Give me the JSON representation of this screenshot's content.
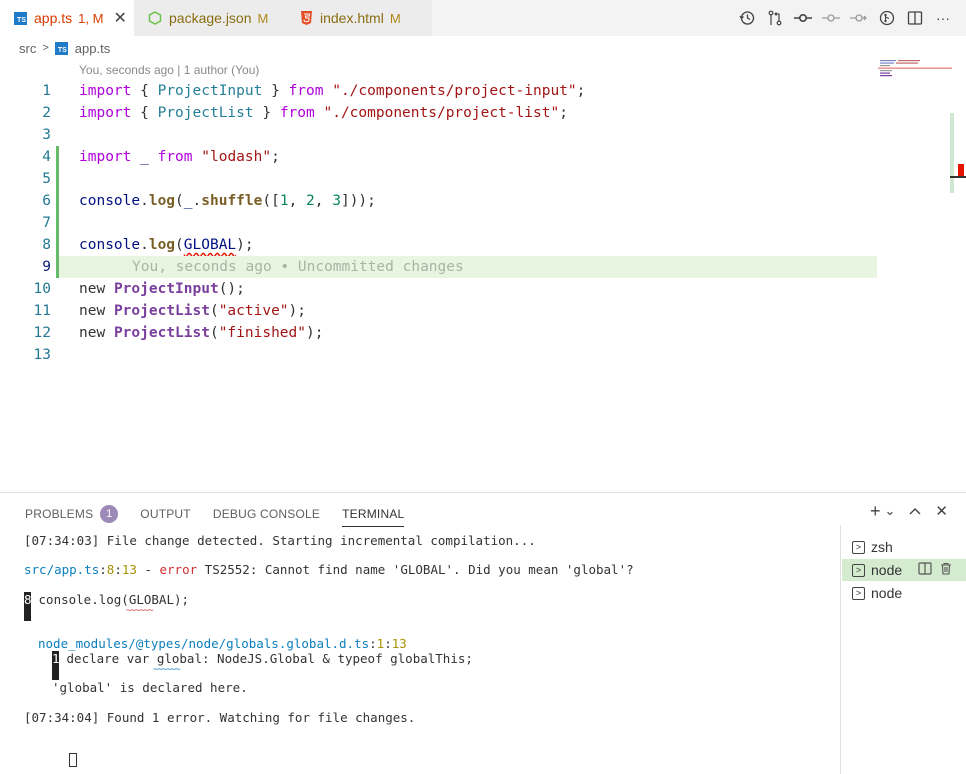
{
  "tabs": [
    {
      "label": "app.ts",
      "status": "1, M",
      "icon": "typescript-icon",
      "active": true,
      "close": "✕"
    },
    {
      "label": "package.json",
      "status": "M",
      "icon": "nodejs-icon",
      "active": false
    },
    {
      "label": "index.html",
      "status": "M",
      "icon": "html5-icon",
      "active": false
    }
  ],
  "toolbar": {
    "icons": [
      "timeline-history-icon",
      "compare-changes-icon",
      "git-commit-icon",
      "previous-change-icon",
      "next-change-icon",
      "open-changes-icon",
      "split-editor-icon",
      "more-actions-icon"
    ],
    "more": "···"
  },
  "breadcrumb": {
    "folder": "src",
    "file": "app.ts"
  },
  "editor": {
    "blame_header": "You, seconds ago | 1 author (You)",
    "line_numbers": [
      "1",
      "2",
      "3",
      "4",
      "5",
      "6",
      "7",
      "8",
      "9",
      "10",
      "11",
      "12",
      "13"
    ],
    "ghost_text": "You, seconds ago • Uncommitted changes",
    "current_line": 9,
    "error_token": "GLOBAL"
  },
  "panel": {
    "tabs": [
      {
        "label": "PROBLEMS",
        "badge": "1"
      },
      {
        "label": "OUTPUT"
      },
      {
        "label": "DEBUG CONSOLE"
      },
      {
        "label": "TERMINAL",
        "active": true
      }
    ],
    "actions": [
      "+",
      "⌄",
      "^",
      "✕"
    ]
  },
  "terminal": {
    "line1": "[07:34:03] File change detected. Starting incremental compilation...",
    "err_file": "src/app.ts",
    "err_line": "8",
    "err_col": "13",
    "err_dash": " - ",
    "err_word": "error",
    "err_code": " TS2552: ",
    "err_msg": "Cannot find name 'GLOBAL'. Did you mean 'global'?",
    "src_ln": "8",
    "src_code": " console.log(GLOBAL);",
    "ref_file": "node_modules/@types/node/globals.global.d.ts",
    "ref_line": "1",
    "ref_col": "13",
    "ref_ln": "1",
    "ref_code": " declare var global: NodeJS.Global & typeof globalThis;",
    "ref_note": "'global' is declared here.",
    "found": "[07:34:04] Found 1 error. Watching for file changes."
  },
  "terminal_list": [
    {
      "label": "zsh"
    },
    {
      "label": "node",
      "active": true
    },
    {
      "label": "node"
    }
  ],
  "colors": {
    "accent_green": "#66bb6a",
    "error_red": "#e51400",
    "badge_purple": "#9d8ab8"
  }
}
